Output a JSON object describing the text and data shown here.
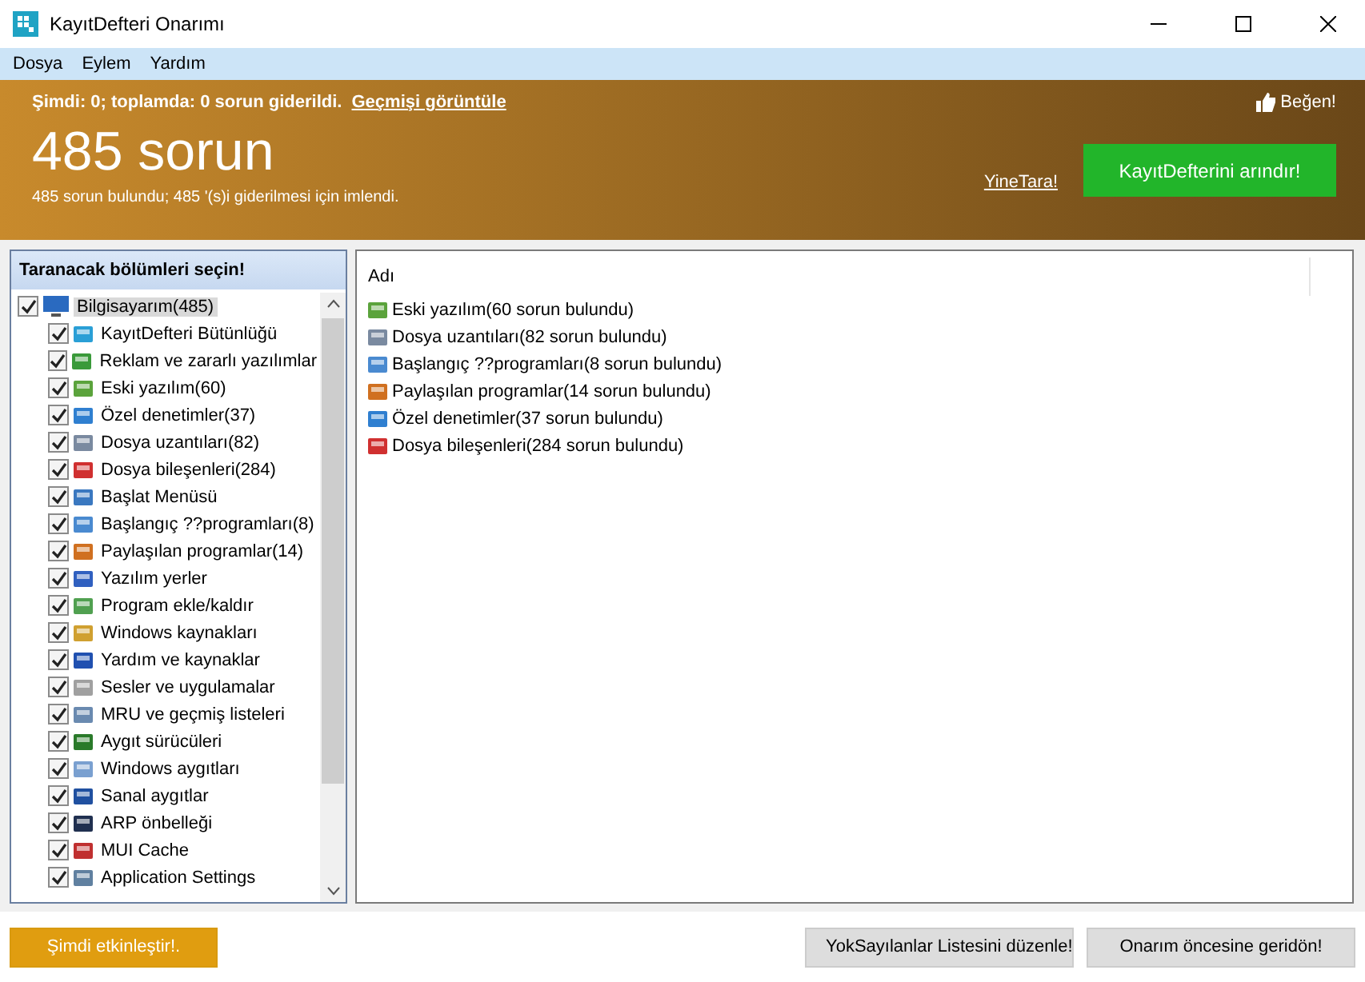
{
  "window": {
    "title": "KayıtDefteri Onarımı"
  },
  "menu": [
    "Dosya",
    "Eylem",
    "Yardım"
  ],
  "banner": {
    "status": "Şimdi: 0; toplamda: 0 sorun giderildi.",
    "history_link": "Geçmişi görüntüle",
    "like": "Beğen!",
    "headline": "485 sorun",
    "summary": "485 sorun bulundu; 485 '(s)i giderilmesi için imlendi.",
    "rescan_link": "YineTara!",
    "clean_button": "KayıtDefterini arındır!"
  },
  "sections_panel": {
    "title": "Taranacak bölümleri seçin!",
    "root": {
      "label": "Bilgisayarım(485)",
      "checked": true,
      "selected": true,
      "children": [
        {
          "label": "KayıtDefteri Bütünlüğü",
          "checked": true
        },
        {
          "label": "Reklam ve zararlı yazılımlar",
          "checked": true
        },
        {
          "label": "Eski yazılım(60)",
          "checked": true
        },
        {
          "label": "Özel denetimler(37)",
          "checked": true
        },
        {
          "label": "Dosya uzantıları(82)",
          "checked": true
        },
        {
          "label": "Dosya bileşenleri(284)",
          "checked": true
        },
        {
          "label": "Başlat Menüsü",
          "checked": true
        },
        {
          "label": "Başlangıç ??programları(8)",
          "checked": true
        },
        {
          "label": "Paylaşılan programlar(14)",
          "checked": true
        },
        {
          "label": "Yazılım yerler",
          "checked": true
        },
        {
          "label": "Program ekle/kaldır",
          "checked": true
        },
        {
          "label": "Windows kaynakları",
          "checked": true
        },
        {
          "label": "Yardım ve kaynaklar",
          "checked": true
        },
        {
          "label": "Sesler ve uygulamalar",
          "checked": true
        },
        {
          "label": "MRU ve geçmiş listeleri",
          "checked": true
        },
        {
          "label": "Aygıt sürücüleri",
          "checked": true
        },
        {
          "label": "Windows aygıtları",
          "checked": true
        },
        {
          "label": "Sanal aygıtlar",
          "checked": true
        },
        {
          "label": "ARP önbelleği",
          "checked": true
        },
        {
          "label": "MUI Cache",
          "checked": true
        },
        {
          "label": "Application Settings",
          "checked": true
        }
      ]
    }
  },
  "results": {
    "column": "Adı",
    "rows": [
      "Eski yazılım(60 sorun bulundu)",
      "Dosya uzantıları(82 sorun bulundu)",
      "Başlangıç ??programları(8 sorun bulundu)",
      "Paylaşılan programlar(14 sorun bulundu)",
      "Özel denetimler(37 sorun bulundu)",
      "Dosya bileşenleri(284 sorun bulundu)"
    ]
  },
  "footer": {
    "activate_button": "Şimdi etkinleştir!.",
    "ignore_button": "YokSayılanlar Listesini düzenle!",
    "restore_button": "Onarım öncesine geridön!"
  }
}
